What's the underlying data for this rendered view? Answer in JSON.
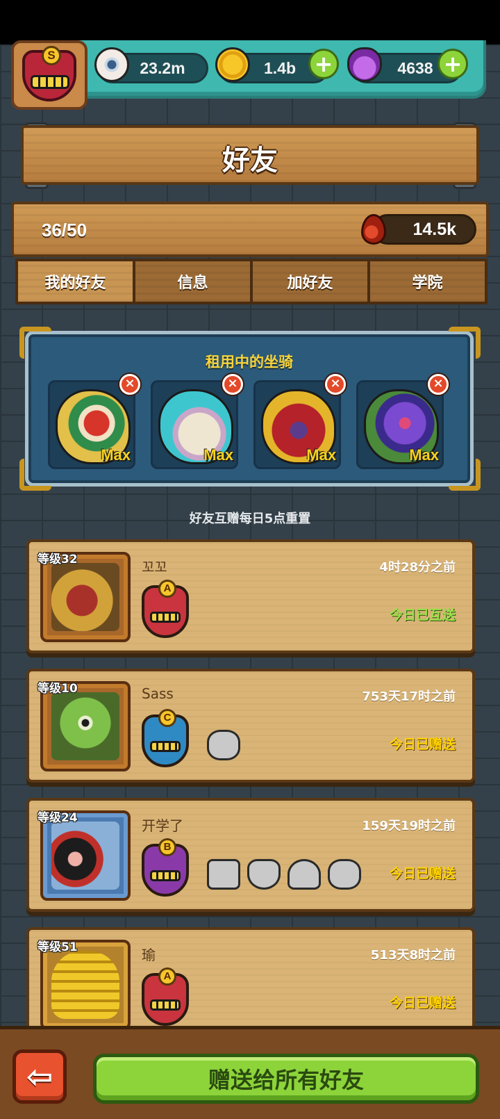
{
  "resources": {
    "eyes": "23.2m",
    "coins": "1.4b",
    "potions": "4638"
  },
  "player": {
    "rank": "S"
  },
  "title": "好友",
  "summary": {
    "friend_count": "36/50",
    "blood": "14.5k"
  },
  "tabs": [
    {
      "label": "我的好友",
      "active": true
    },
    {
      "label": "信息",
      "active": false
    },
    {
      "label": "加好友",
      "active": false
    },
    {
      "label": "学院",
      "active": false
    }
  ],
  "mounts": {
    "title": "租用中的坐骑",
    "slots": [
      {
        "level": "Max",
        "remove_icon": "×"
      },
      {
        "level": "Max",
        "remove_icon": "×"
      },
      {
        "level": "Max",
        "remove_icon": "×"
      },
      {
        "level": "Max",
        "remove_icon": "×"
      }
    ]
  },
  "reset_note": "好友互赠每日5点重置",
  "friends": [
    {
      "level": "等级32",
      "name": "꼬꼬",
      "time": "4时28分之前",
      "status": "今日已互送",
      "rank": "A"
    },
    {
      "level": "等级10",
      "name": "Sass",
      "time": "753天17时之前",
      "status": "今日已赠送",
      "rank": "C"
    },
    {
      "level": "等级24",
      "name": "开学了",
      "time": "159天19时之前",
      "status": "今日已赠送",
      "rank": "B"
    },
    {
      "level": "等级51",
      "name": "瑜",
      "time": "513天8时之前",
      "status": "今日已赠送",
      "rank": "A"
    }
  ],
  "buttons": {
    "back_arrow": "⇦",
    "gift_all": "赠送给所有好友",
    "plus": "+"
  }
}
